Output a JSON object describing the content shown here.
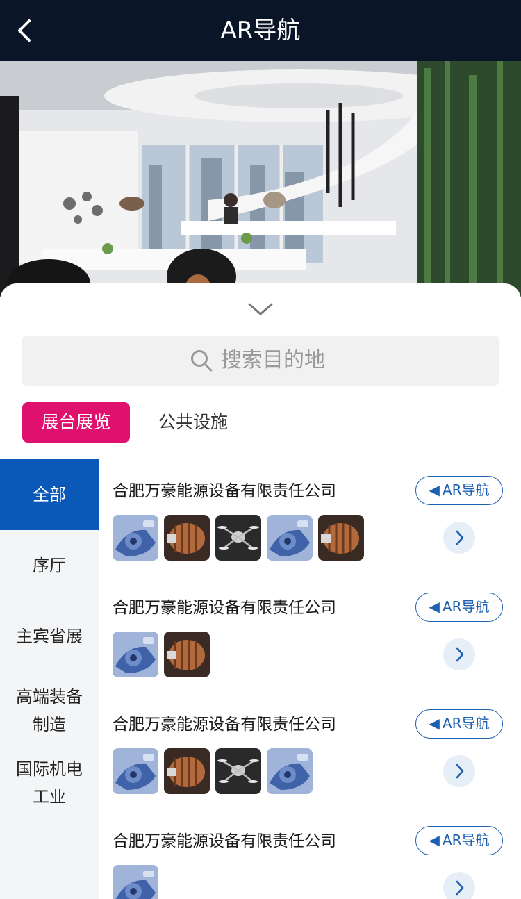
{
  "header": {
    "title": "AR导航"
  },
  "search": {
    "placeholder": "搜索目的地"
  },
  "tabs": [
    {
      "label": "展台展览",
      "active": true
    },
    {
      "label": "公共设施",
      "active": false
    }
  ],
  "categories": [
    {
      "label": "全部",
      "active": true
    },
    {
      "label": "序厅"
    },
    {
      "label": "主宾省展"
    },
    {
      "label": "高端装备制造"
    },
    {
      "label": "国际机电工业"
    }
  ],
  "items": [
    {
      "title": "合肥万豪能源设备有限责任公司",
      "ar_label": "AR导航",
      "thumbs": [
        "blue-machine",
        "copper-motor",
        "drone",
        "blue-machine",
        "copper-motor"
      ]
    },
    {
      "title": "合肥万豪能源设备有限责任公司",
      "ar_label": "AR导航",
      "thumbs": [
        "blue-machine",
        "copper-motor"
      ]
    },
    {
      "title": "合肥万豪能源设备有限责任公司",
      "ar_label": "AR导航",
      "thumbs": [
        "blue-machine",
        "copper-motor",
        "drone",
        "blue-machine"
      ]
    },
    {
      "title": "合肥万豪能源设备有限责任公司",
      "ar_label": "AR导航",
      "thumbs": [
        "blue-machine"
      ]
    }
  ],
  "colors": {
    "header_bg": "#0b1528",
    "tab_active": "#e0106e",
    "category_active": "#0a58b8",
    "ar_button": "#1d5fb0"
  }
}
